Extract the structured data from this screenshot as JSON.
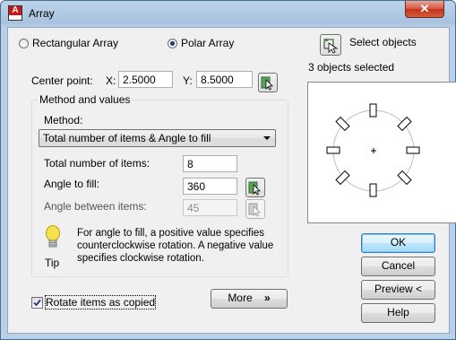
{
  "window": {
    "title": "Array",
    "close_glyph": "✕"
  },
  "array_type": {
    "rectangular_label": "Rectangular Array",
    "polar_label": "Polar Array",
    "selected": "polar"
  },
  "select_objects": {
    "label": "Select objects",
    "status": "3 objects selected"
  },
  "center_point": {
    "label": "Center point:",
    "x_label": "X:",
    "x_value": "2.5000",
    "y_label": "Y:",
    "y_value": "8.5000"
  },
  "method_group": {
    "title": "Method and values",
    "method_label": "Method:",
    "method_value": "Total number of items & Angle to fill",
    "total_items_label": "Total number of items:",
    "total_items_value": "8",
    "angle_fill_label": "Angle to fill:",
    "angle_fill_value": "360",
    "angle_between_label": "Angle between items:",
    "angle_between_value": "45"
  },
  "tip": {
    "text": "For angle to fill, a positive value specifies counterclockwise rotation.  A negative value specifies clockwise rotation.",
    "label": "Tip"
  },
  "rotate": {
    "label": "Rotate items as copied",
    "checked": true
  },
  "buttons": {
    "more": "More",
    "more_glyph": "»",
    "ok": "OK",
    "cancel": "Cancel",
    "preview": "Preview <",
    "help": "Help"
  },
  "colors": {
    "accent": "#3c7fb1",
    "close": "#c2321b",
    "titlebar": "#bcd3ea"
  }
}
